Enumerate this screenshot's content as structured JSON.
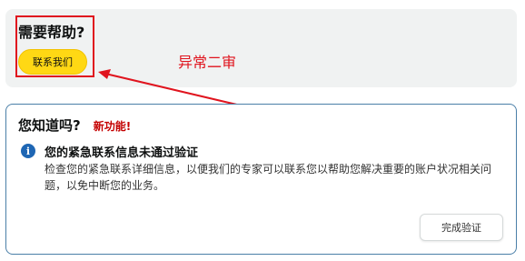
{
  "help": {
    "title": "需要帮助?",
    "contact_label": "联系我们"
  },
  "annotation": {
    "text": "异常二审",
    "color": "#e0141e"
  },
  "card": {
    "title": "您知道吗?",
    "badge": "新功能!",
    "alert_title": "您的紧急联系信息未通过验证",
    "alert_body": "检查您的紧急联系详细信息，以便我们的专家可以联系您以帮助您解决重要的账户状况相关问题，以免中断您的业务。",
    "verify_label": "完成验证",
    "icon": "info-icon"
  },
  "colors": {
    "primary_button": "#ffd814",
    "info_blue": "#1e66b4",
    "badge_red": "#c40000"
  }
}
